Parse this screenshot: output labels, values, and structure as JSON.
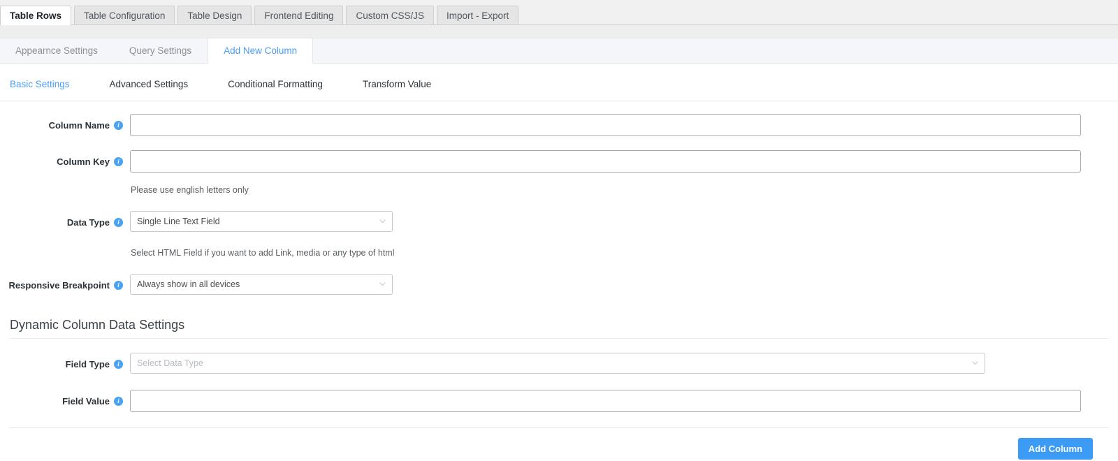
{
  "top_tabs": [
    {
      "label": "Table Rows",
      "active": true
    },
    {
      "label": "Table Configuration",
      "active": false
    },
    {
      "label": "Table Design",
      "active": false
    },
    {
      "label": "Frontend Editing",
      "active": false
    },
    {
      "label": "Custom CSS/JS",
      "active": false
    },
    {
      "label": "Import - Export",
      "active": false
    }
  ],
  "sub_tabs": [
    {
      "label": "Appearnce Settings",
      "active": false
    },
    {
      "label": "Query Settings",
      "active": false
    },
    {
      "label": "Add New Column",
      "active": true
    }
  ],
  "inner_tabs": [
    {
      "label": "Basic Settings",
      "active": true
    },
    {
      "label": "Advanced Settings",
      "active": false
    },
    {
      "label": "Conditional Formatting",
      "active": false
    },
    {
      "label": "Transform Value",
      "active": false
    }
  ],
  "form": {
    "column_name": {
      "label": "Column Name",
      "value": "",
      "placeholder": ""
    },
    "column_key": {
      "label": "Column Key",
      "value": "",
      "placeholder": "",
      "helper": "Please use english letters only"
    },
    "data_type": {
      "label": "Data Type",
      "value": "Single Line Text Field",
      "helper": "Select HTML Field if you want to add Link, media or any type of html"
    },
    "responsive_breakpoint": {
      "label": "Responsive Breakpoint",
      "value": "Always show in all devices"
    }
  },
  "dynamic_section": {
    "heading": "Dynamic Column Data Settings",
    "field_type": {
      "label": "Field Type",
      "value": "",
      "placeholder": "Select Data Type"
    },
    "field_value": {
      "label": "Field Value",
      "value": "",
      "placeholder": ""
    }
  },
  "footer": {
    "add_column_label": "Add Column"
  },
  "colors": {
    "accent": "#4a9df8",
    "primary_button": "#3b9bf5",
    "info_icon": "#4aa3f0",
    "subbar_bg": "#f5f6fa"
  }
}
